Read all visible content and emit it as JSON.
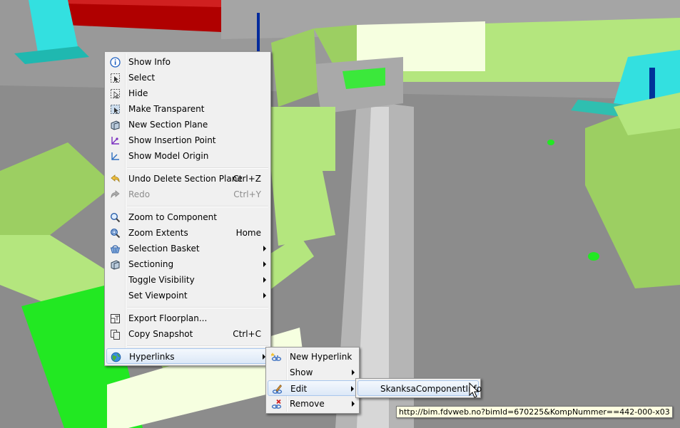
{
  "main_menu": {
    "items": [
      {
        "label": "Show Info",
        "icon": "info-icon"
      },
      {
        "label": "Select",
        "icon": "select-icon"
      },
      {
        "label": "Hide",
        "icon": "hide-icon"
      },
      {
        "label": "Make Transparent",
        "icon": "transparent-icon"
      },
      {
        "label": "New Section Plane",
        "icon": "section-plane-icon"
      },
      {
        "label": "Show Insertion Point",
        "icon": "insertion-point-icon"
      },
      {
        "label": "Show Model Origin",
        "icon": "model-origin-icon"
      },
      {
        "label": "Undo Delete Section Plane",
        "shortcut": "Ctrl+Z",
        "icon": "undo-icon"
      },
      {
        "label": "Redo",
        "shortcut": "Ctrl+Y",
        "icon": "redo-icon",
        "disabled": true
      },
      {
        "label": "Zoom to Component",
        "icon": "zoom-icon"
      },
      {
        "label": "Zoom Extents",
        "shortcut": "Home",
        "icon": "zoom-extents-icon"
      },
      {
        "label": "Selection Basket",
        "icon": "basket-icon"
      },
      {
        "label": "Sectioning",
        "icon": "sectioning-icon"
      },
      {
        "label": "Toggle Visibility"
      },
      {
        "label": "Set Viewpoint"
      },
      {
        "label": "Export Floorplan...",
        "icon": "floorplan-icon"
      },
      {
        "label": "Copy Snapshot",
        "shortcut": "Ctrl+C",
        "icon": "snapshot-icon"
      },
      {
        "label": "Hyperlinks",
        "icon": "globe-icon",
        "highlighted": true
      }
    ]
  },
  "hyperlinks_menu": {
    "items": [
      {
        "label": "New Hyperlink",
        "icon": "new-hyperlink-icon"
      },
      {
        "label": "Show"
      },
      {
        "label": "Edit",
        "icon": "edit-icon",
        "highlighted": true
      },
      {
        "label": "Remove",
        "icon": "remove-icon"
      }
    ]
  },
  "edit_menu": {
    "items": [
      {
        "label": "SkanksaComponentInfo",
        "highlighted": true
      }
    ]
  },
  "tooltip": {
    "text": "http://bim.fdvweb.no?bimId=670225&KompNummer==442-000-x03"
  },
  "colors": {
    "menu_bg": "#f0f0f0",
    "highlight": "#dce8f7",
    "scene_floor": "#8a8a8a",
    "pipe_green": "#b4e67e",
    "duct_cyan": "#33e0e0",
    "beam_red": "#b00000"
  }
}
